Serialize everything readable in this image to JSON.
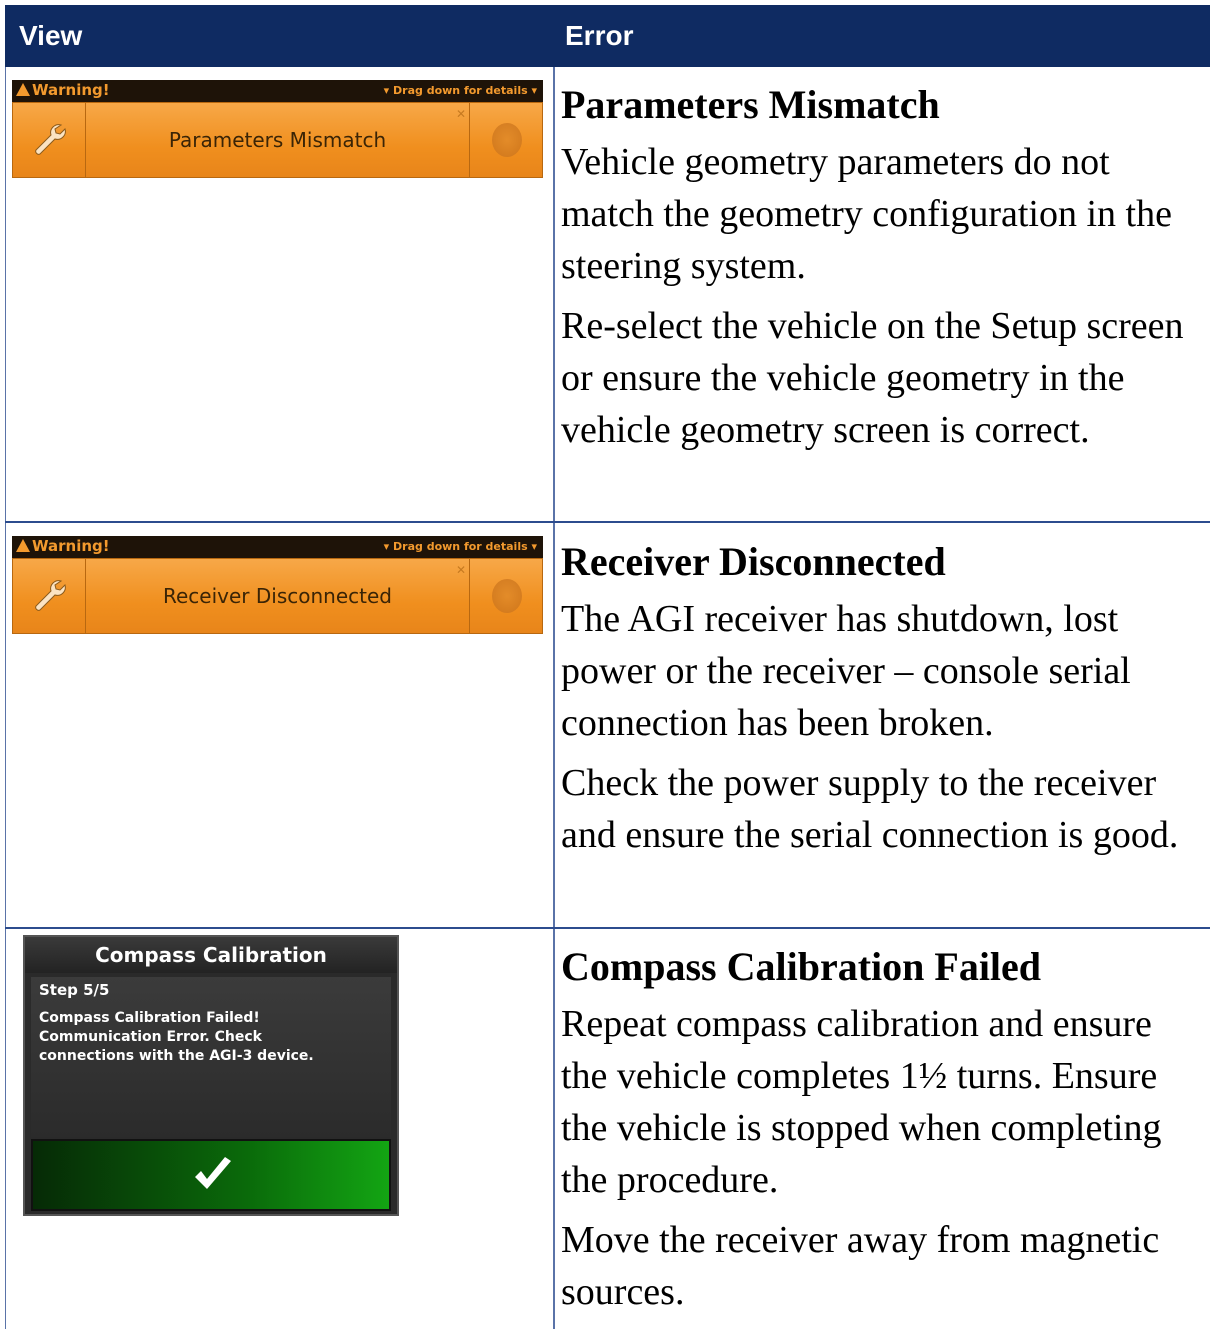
{
  "table": {
    "headers": {
      "view": "View",
      "error": "Error"
    }
  },
  "rows": [
    {
      "banner": {
        "heading": "Warning!",
        "drag_hint": "▾ Drag down for details ▾",
        "message": "Parameters Mismatch",
        "wrench_icon": "wrench-icon",
        "sound_icon": "sound-icon",
        "close_icon": "close-x-icon"
      },
      "title": "Parameters Mismatch",
      "paragraphs": [
        "Vehicle geometry parameters do not match the geometry configuration in the steering system.",
        "Re-select the vehicle on the Setup screen or ensure the vehicle geometry in the vehicle geometry screen is correct."
      ]
    },
    {
      "banner": {
        "heading": "Warning!",
        "drag_hint": "▾ Drag down for details ▾",
        "message": "Receiver Disconnected",
        "wrench_icon": "wrench-icon",
        "sound_icon": "sound-icon",
        "close_icon": "close-x-icon"
      },
      "title": "Receiver Disconnected",
      "paragraphs": [
        "The AGI receiver has shutdown, lost power or the receiver – console serial connection has been broken.",
        "Check the power supply to the receiver and ensure the serial connection is good."
      ]
    },
    {
      "dialog": {
        "title": "Compass Calibration",
        "step": "Step 5/5",
        "lines": [
          "Compass Calibration Failed!",
          "Communication Error. Check",
          "connections with the AGI-3 device."
        ],
        "confirm_icon": "checkmark-icon"
      },
      "title": "Compass Calibration Failed",
      "paragraphs": [
        "Repeat compass calibration and ensure the vehicle completes 1½ turns. Ensure the vehicle is stopped when completing the procedure.",
        "Move the receiver away from magnetic sources."
      ]
    }
  ],
  "colors": {
    "header_bg": "#0f2b62",
    "warning_orange": "#f08f1e",
    "confirm_green": "#13a513"
  }
}
